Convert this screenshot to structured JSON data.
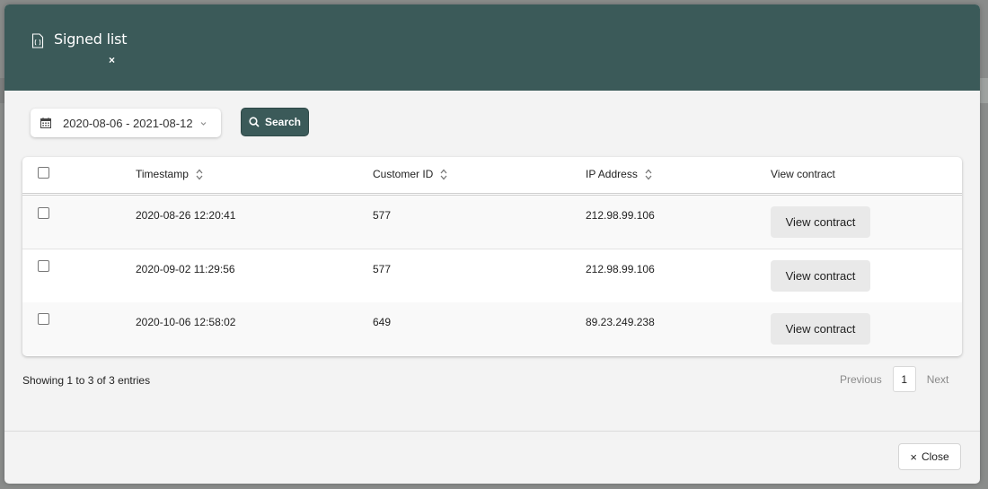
{
  "colors": {
    "header": "#3b5a59",
    "accent": "#3b5a59",
    "modal_bg": "#f3f3f3"
  },
  "modal": {
    "title": "Signed list",
    "title_icon": "contract-file-icon",
    "close_x": "×"
  },
  "filters": {
    "date_range": "2020-08-06 - 2021-08-12",
    "search_label": "Search"
  },
  "table": {
    "headers": {
      "timestamp": "Timestamp",
      "customer_id": "Customer ID",
      "ip_address": "IP Address",
      "view_contract": "View contract"
    },
    "rows": [
      {
        "timestamp": "2020-08-26 12:20:41",
        "customer_id": "577",
        "ip": "212.98.99.106",
        "action": "View contract"
      },
      {
        "timestamp": "2020-09-02 11:29:56",
        "customer_id": "577",
        "ip": "212.98.99.106",
        "action": "View contract"
      },
      {
        "timestamp": "2020-10-06 12:58:02",
        "customer_id": "649",
        "ip": "89.23.249.238",
        "action": "View contract"
      }
    ]
  },
  "pagination": {
    "summary": "Showing 1 to 3 of 3 entries",
    "previous": "Previous",
    "current_page": "1",
    "next": "Next"
  },
  "footer": {
    "close_label": "Close",
    "close_icon": "×"
  }
}
